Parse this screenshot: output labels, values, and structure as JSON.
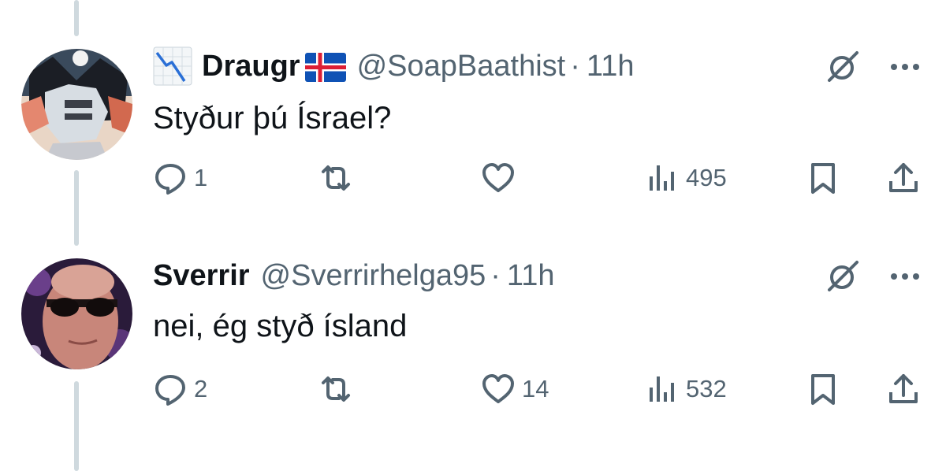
{
  "tweets": [
    {
      "name": "Draugr",
      "handle": "@SoapBaathist",
      "dot": "·",
      "time": "11h",
      "text": "Styður þú Ísrael?",
      "actions": {
        "replies": "1",
        "retweets": "",
        "likes": "",
        "views": "495"
      },
      "name_emoji_left": "chart-decreasing-icon",
      "name_emoji_right": "iceland-flag-icon"
    },
    {
      "name": "Sverrir",
      "handle": "@Sverrirhelga95",
      "dot": "·",
      "time": "11h",
      "text": "nei, ég styð ísland",
      "actions": {
        "replies": "2",
        "retweets": "",
        "likes": "14",
        "views": "532"
      }
    }
  ],
  "colors": {
    "text": "#0f1419",
    "secondary": "#536471",
    "thread_line": "#cfd9de"
  }
}
